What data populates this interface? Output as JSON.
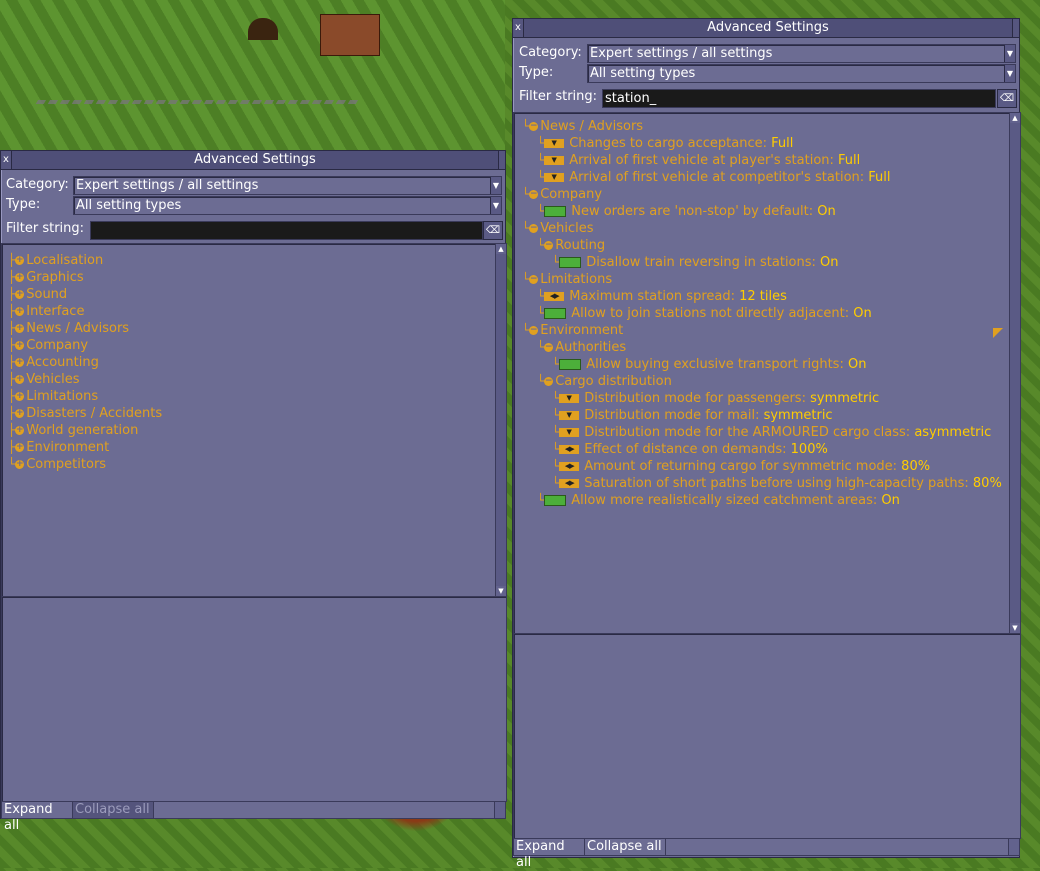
{
  "left": {
    "title": "Advanced Settings",
    "close_glyph": "x",
    "category_label": "Category:",
    "category_value": "Expert settings / all settings",
    "type_label": "Type:",
    "type_value": "All setting types",
    "filter_label": "Filter string:",
    "filter_value": "",
    "tree": [
      "Localisation",
      "Graphics",
      "Sound",
      "Interface",
      "News / Advisors",
      "Company",
      "Accounting",
      "Vehicles",
      "Limitations",
      "Disasters / Accidents",
      "World generation",
      "Environment",
      "Competitors"
    ],
    "expand_label": "Expand all",
    "collapse_label": "Collapse all"
  },
  "right": {
    "title": "Advanced Settings",
    "close_glyph": "x",
    "category_label": "Category:",
    "category_value": "Expert settings / all settings",
    "type_label": "Type:",
    "type_value": "All setting types",
    "filter_label": "Filter string:",
    "filter_value": "station_",
    "rows": [
      {
        "name": "News / Advisors"
      },
      {
        "name": "Changes to cargo acceptance:",
        "value": "Full"
      },
      {
        "name": "Arrival of first vehicle at player's station:",
        "value": "Full"
      },
      {
        "name": "Arrival of first vehicle at competitor's station:",
        "value": "Full"
      },
      {
        "name": "Company"
      },
      {
        "name": "New orders are 'non-stop' by default:",
        "value": "On"
      },
      {
        "name": "Vehicles"
      },
      {
        "name": "Routing"
      },
      {
        "name": "Disallow train reversing in stations:",
        "value": "On"
      },
      {
        "name": "Limitations"
      },
      {
        "name": "Maximum station spread:",
        "value": "12 tiles"
      },
      {
        "name": "Allow to join stations not directly adjacent:",
        "value": "On"
      },
      {
        "name": "Environment"
      },
      {
        "name": "Authorities"
      },
      {
        "name": "Allow buying exclusive transport rights:",
        "value": "On"
      },
      {
        "name": "Cargo distribution"
      },
      {
        "name": "Distribution mode for passengers:",
        "value": "symmetric"
      },
      {
        "name": "Distribution mode for mail:",
        "value": "symmetric"
      },
      {
        "name": "Distribution mode for the ARMOURED cargo class:",
        "value": "asymmetric"
      },
      {
        "name": "Effect of distance on demands:",
        "value": "100%"
      },
      {
        "name": "Amount of returning cargo for symmetric mode:",
        "value": "80%"
      },
      {
        "name": "Saturation of short paths before using high-capacity paths:",
        "value": "80%"
      },
      {
        "name": "Allow more realistically sized catchment areas:",
        "value": "On"
      }
    ],
    "expand_label": "Expand all",
    "collapse_label": "Collapse all"
  },
  "colors": {
    "accent": "#e0a020",
    "window": "#6c6c93",
    "title": "#4f4f78",
    "toggle_on": "#4caf3a"
  }
}
